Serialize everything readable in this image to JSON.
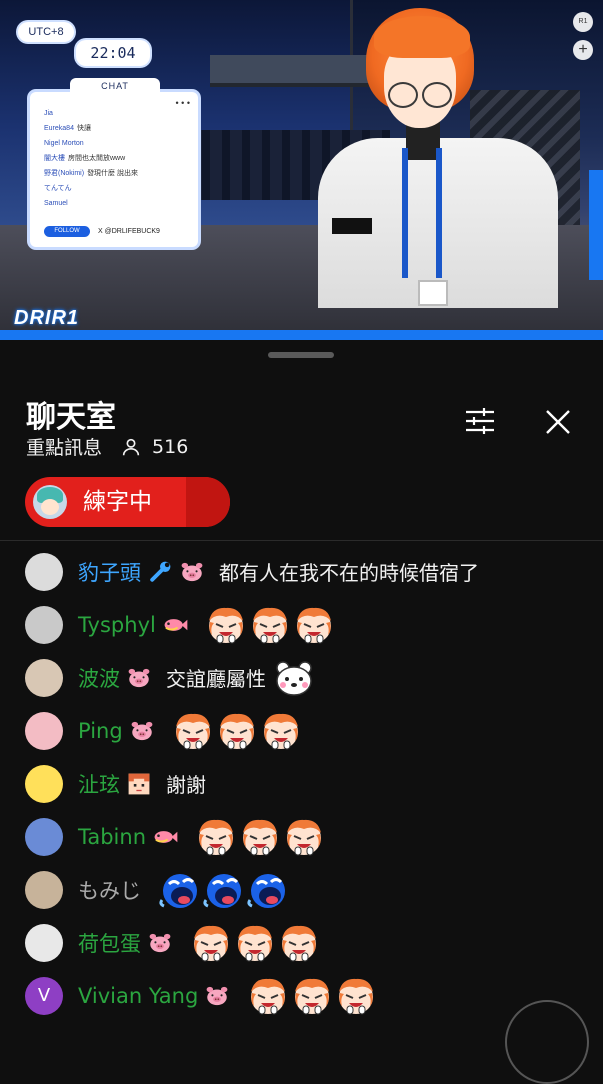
{
  "stream": {
    "timezone": "UTC+8",
    "clock": "22:04",
    "overlay_chat": {
      "title": "CHAT",
      "menu": "• • •",
      "messages": [
        {
          "name": "Jia",
          "text": ""
        },
        {
          "name": "Eureka84",
          "text": "快讓"
        },
        {
          "name": "Nigel Morton",
          "text": ""
        },
        {
          "name": "闇大樓",
          "text": "房間也太閒放www"
        },
        {
          "name": "野君(Nokimi)",
          "text": "發現什麼 說出來"
        },
        {
          "name": "てんてん",
          "text": ""
        },
        {
          "name": "Samuel",
          "text": ""
        }
      ],
      "follow_label": "FOLLOW",
      "handle": "X @DRLIFEBUCK9"
    },
    "logo_text": "DRIR1",
    "r1_button": "R1",
    "plus_button": "+",
    "colors": {
      "accent_blue": "#1877f2"
    }
  },
  "panel": {
    "title": "聊天室",
    "subtitle": "重點訊息",
    "viewer_count": "516",
    "pinned_label": "練字中",
    "colors": {
      "pinned_bg": "#e2201c",
      "name_green": "#2ba640",
      "name_blue": "#3ea6ff",
      "name_gray": "#aaaaaa"
    }
  },
  "messages": [
    {
      "author": "豹子頭",
      "color": "#3ea6ff",
      "badges": [
        "wrench-icon",
        "pig-badge"
      ],
      "text": "都有人在我不在的時候借宿了",
      "emotes": [],
      "avatar": "#dcdcdc"
    },
    {
      "author": "Tysphyl",
      "color": "#2ba640",
      "badges": [
        "fish-badge"
      ],
      "text": "",
      "emotes": [
        "face-emote",
        "face-emote",
        "face-emote"
      ],
      "avatar": "#c9c9c9"
    },
    {
      "author": "波波",
      "color": "#2ba640",
      "badges": [
        "pig-badge"
      ],
      "text": "交誼廳屬性",
      "emotes": [
        "bear-emote"
      ],
      "avatar": "#d8c7b4"
    },
    {
      "author": "Ping",
      "color": "#2ba640",
      "badges": [
        "pig-badge"
      ],
      "text": "",
      "emotes": [
        "face-emote",
        "face-emote",
        "face-emote"
      ],
      "avatar": "#f3bcc4"
    },
    {
      "author": "沚玹",
      "color": "#2ba640",
      "badges": [
        "boy-badge"
      ],
      "text": "謝謝",
      "emotes": [],
      "avatar": "#ffe05a"
    },
    {
      "author": "Tabinn",
      "color": "#2ba640",
      "badges": [
        "fish-badge"
      ],
      "text": "",
      "emotes": [
        "face-emote",
        "face-emote",
        "face-emote"
      ],
      "avatar": "#6a8bd6"
    },
    {
      "author": "もみじ",
      "color": "#aaaaaa",
      "badges": [],
      "text": "",
      "emotes": [
        "blue-laugh-emote",
        "blue-laugh-emote",
        "blue-laugh-emote"
      ],
      "avatar": "#c7b39a"
    },
    {
      "author": "荷包蛋",
      "color": "#2ba640",
      "badges": [
        "pig-badge"
      ],
      "text": "",
      "emotes": [
        "face-emote",
        "face-emote",
        "face-emote"
      ],
      "avatar": "#e8e8e8"
    },
    {
      "author": "Vivian Yang",
      "color": "#2ba640",
      "badges": [
        "pig-badge"
      ],
      "text": "",
      "emotes": [
        "face-emote",
        "face-emote",
        "face-emote"
      ],
      "avatar": "#8e3fc4",
      "initial": "V"
    }
  ]
}
